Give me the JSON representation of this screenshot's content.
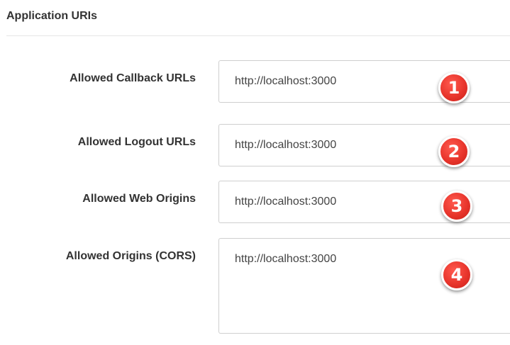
{
  "section": {
    "title": "Application URIs"
  },
  "fields": [
    {
      "label": "Allowed Callback URLs",
      "value": "http://localhost:3000",
      "badge": "1"
    },
    {
      "label": "Allowed Logout URLs",
      "value": "http://localhost:3000",
      "badge": "2"
    },
    {
      "label": "Allowed Web Origins",
      "value": "http://localhost:3000",
      "badge": "3"
    },
    {
      "label": "Allowed Origins (CORS)",
      "value": "http://localhost:3000",
      "badge": "4"
    }
  ],
  "colors": {
    "badge": "#e8352c",
    "label": "#333333",
    "border": "#cfcfcf"
  }
}
